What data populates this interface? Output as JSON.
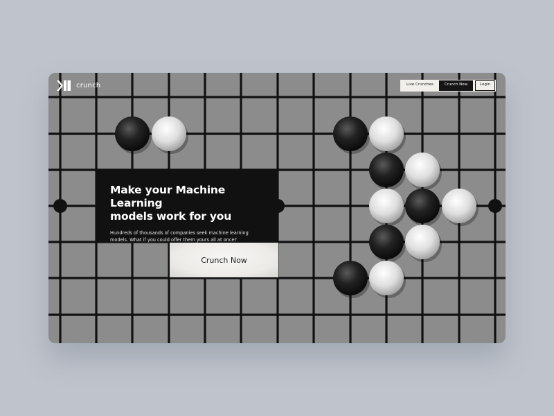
{
  "brand": {
    "name": "crunch",
    "icon": "crunch-logo-icon"
  },
  "nav": {
    "live_crunches": "Live Crunches",
    "crunch_now": "Crunch Now",
    "login": "Login"
  },
  "hero": {
    "title_line1": "Make your Machine Learning",
    "title_line2": "models work for you",
    "subtitle_line1": "Hundreds of thousands of companies seek machine learning",
    "subtitle_line2": "models. What if you could offer them yours all at once?",
    "cta": "Crunch Now"
  },
  "colors": {
    "page_background": "#bfc4cc",
    "board": "#8c8c8c",
    "grid_line": "#111111",
    "black_stone": "#1a1a1a",
    "white_stone": "#e6e6e6",
    "card": "#111111"
  }
}
